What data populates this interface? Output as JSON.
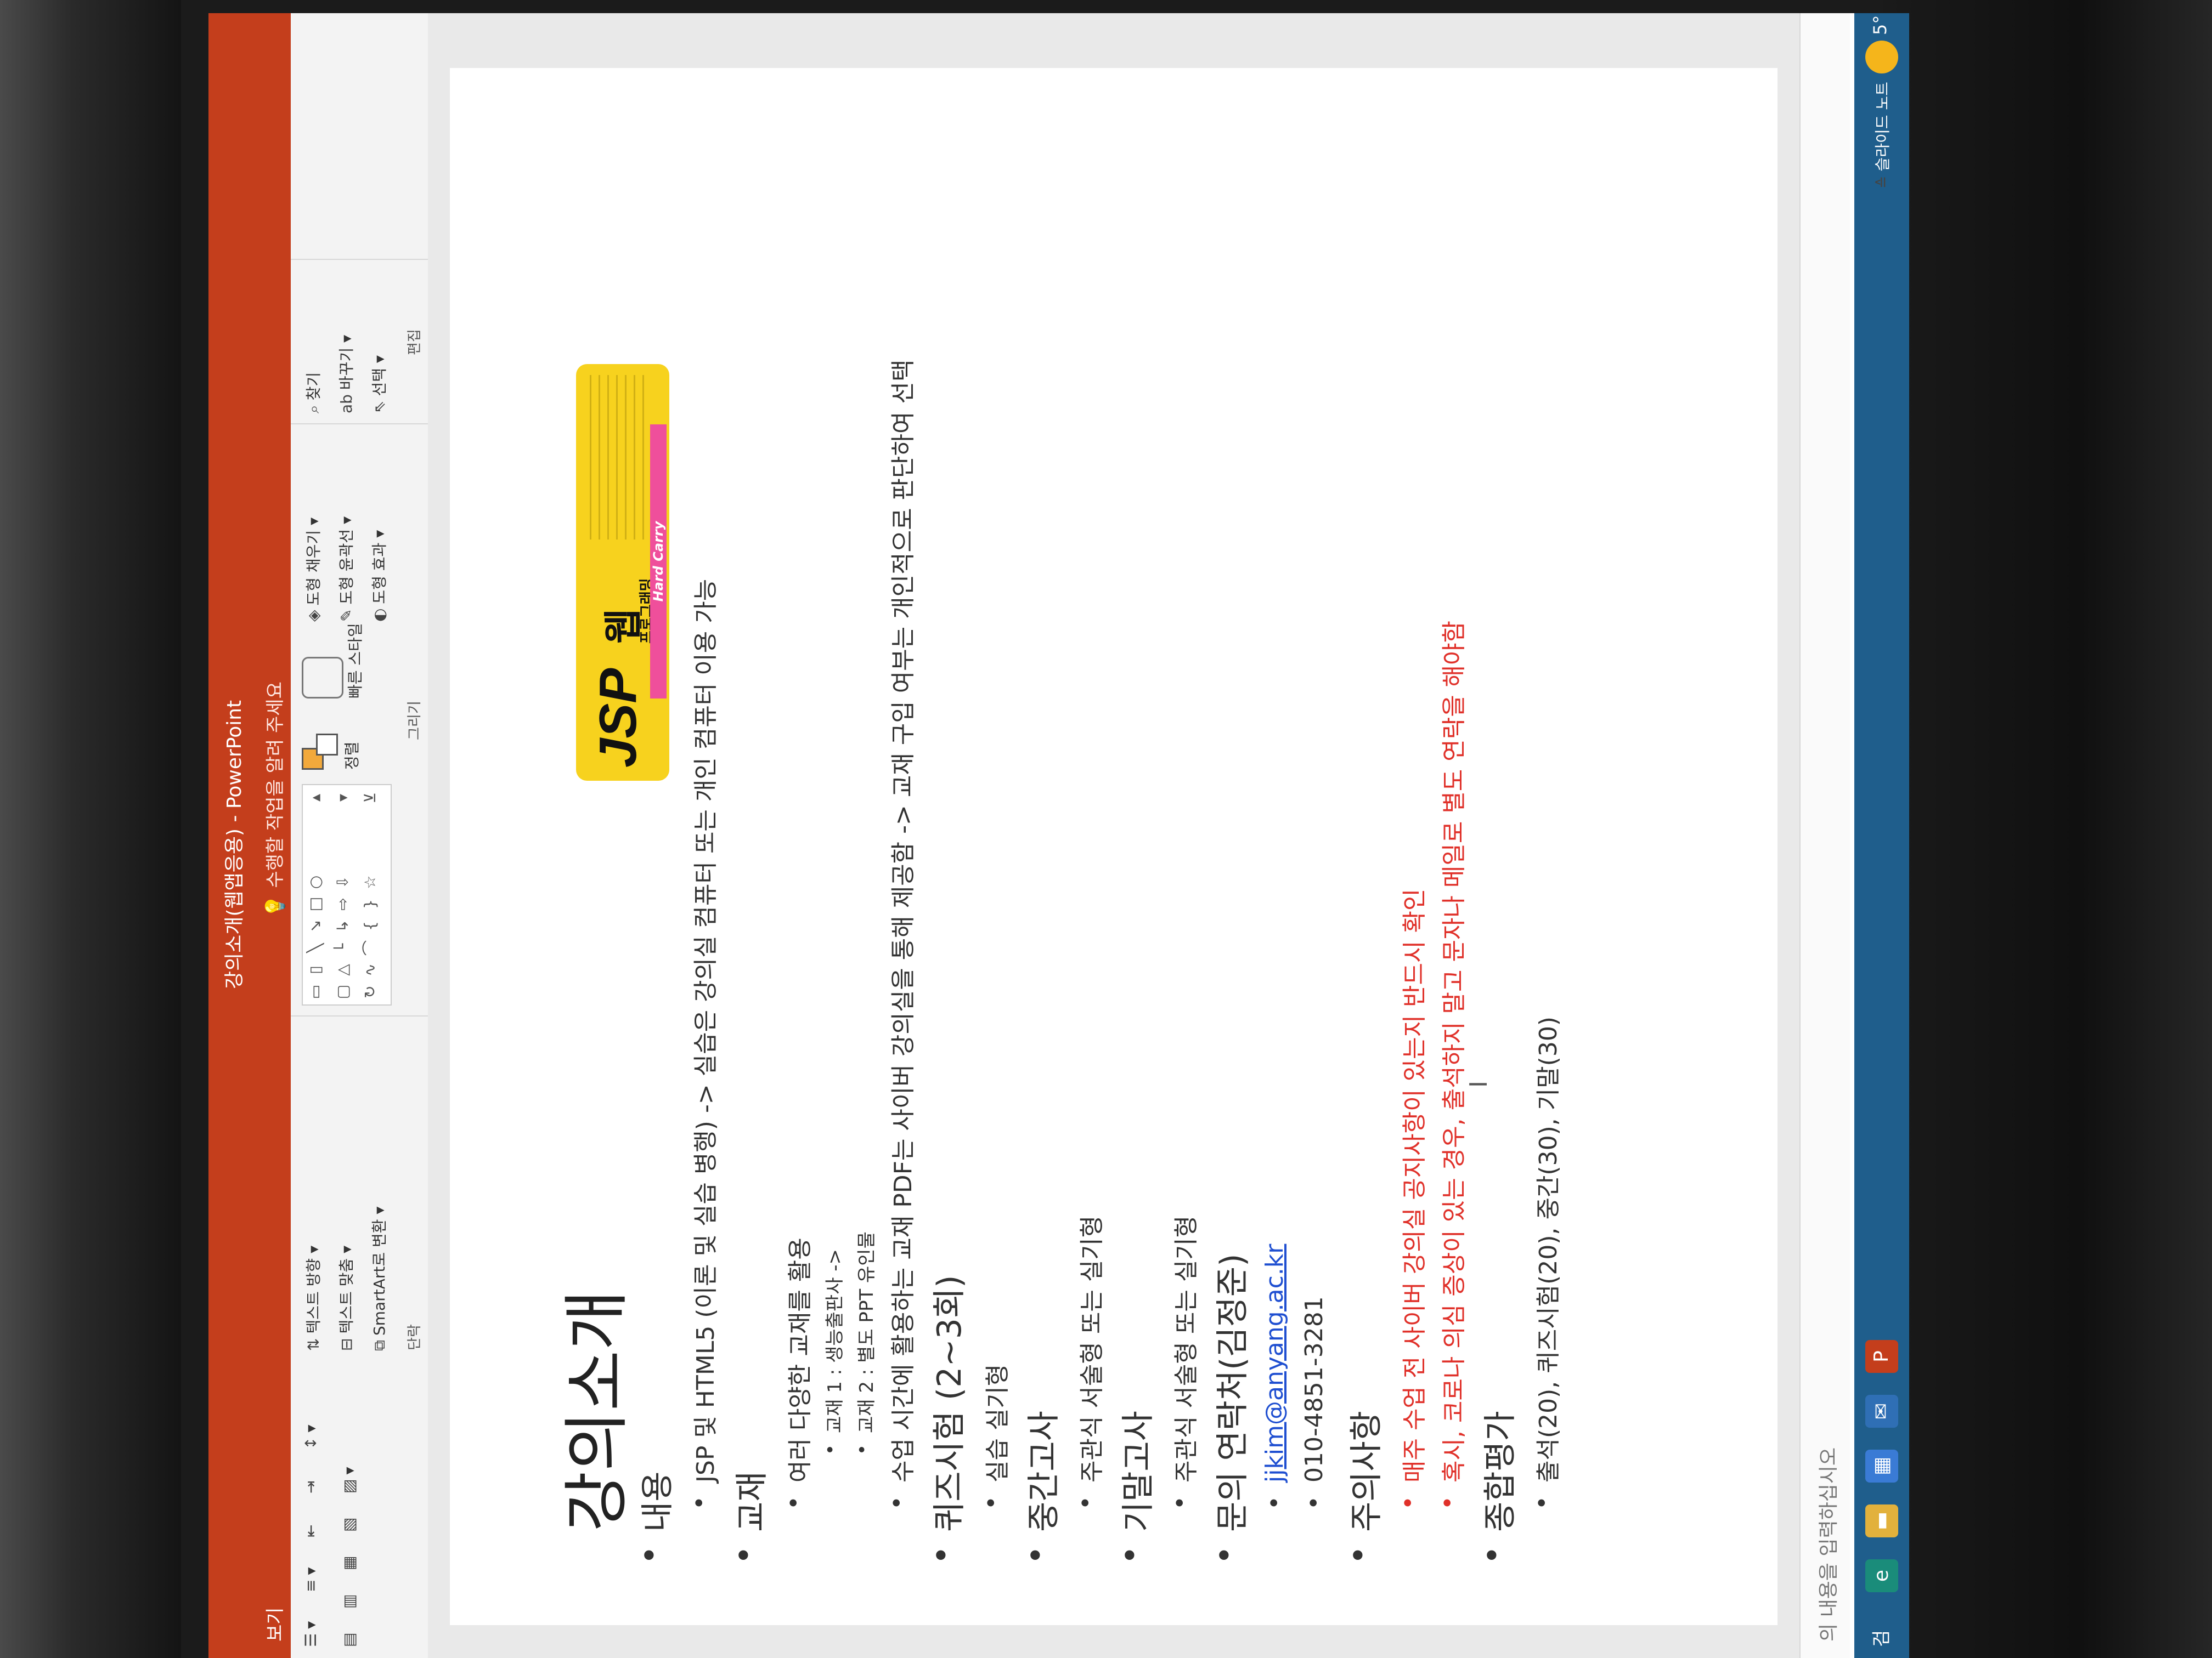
{
  "window": {
    "title": "강의소개(웹앱응용) - PowerPoint"
  },
  "tabs": {
    "view": "보기",
    "tell_me": "수행할 작업을 알려 주세요"
  },
  "ribbon": {
    "paragraph": {
      "label": "단락",
      "text_direction": "텍스트 방향",
      "align_text": "텍스트 맞춤",
      "smartart": "SmartArt로 변환"
    },
    "drawing": {
      "label": "그리기",
      "arrange": "정렬",
      "quick_styles": "빠른 스타일",
      "shape_fill": "도형 채우기",
      "shape_outline": "도형 윤곽선",
      "shape_effects": "도형 효과"
    },
    "editing": {
      "label": "편집",
      "find": "찾기",
      "replace": "바꾸기",
      "select": "선택"
    }
  },
  "slide": {
    "title": "강의소개",
    "items": [
      {
        "level": 1,
        "text": "내용",
        "red": false
      },
      {
        "level": 2,
        "text": "JSP 및 HTML5 (이론 및 실습 병행) -> 실습은 강의실 컴퓨터 또는 개인 컴퓨터 이용 가능",
        "red": false
      },
      {
        "level": 1,
        "text": "교재",
        "red": false
      },
      {
        "level": 2,
        "text": "여러 다양한 교재를 활용",
        "red": false
      },
      {
        "level": 3,
        "text": "교재 1 : 생능출판사 ->",
        "red": false
      },
      {
        "level": 3,
        "text": "교재 2 : 별도 PPT 유인물",
        "red": false
      },
      {
        "level": 2,
        "text": "수업 시간에 활용하는 교재 PDF는 사이버 강의실을 통해 제공함 -> 교재 구입 여부는 개인적으로 판단하여 선택",
        "red": false
      },
      {
        "level": 1,
        "text": "퀴즈시험 (2~3회)",
        "red": false
      },
      {
        "level": 2,
        "text": "실습 실기형",
        "red": false
      },
      {
        "level": 1,
        "text": "중간고사",
        "red": false
      },
      {
        "level": 2,
        "text": "주관식 서술형 또는 실기형",
        "red": false
      },
      {
        "level": 1,
        "text": "기말고사",
        "red": false
      },
      {
        "level": 2,
        "text": "주관식 서술형 또는 실기형",
        "red": false
      },
      {
        "level": 1,
        "text": "문의 연락처(김정준)",
        "red": false
      },
      {
        "level": 2,
        "text": "jjkim@anyang.ac.kr",
        "red": false,
        "link": true
      },
      {
        "level": 2,
        "text": "010-4851-3281",
        "red": false
      },
      {
        "level": 1,
        "text": "주의사항",
        "red": false
      },
      {
        "level": 2,
        "text": "매주 수업 전 사이버 강의실 공지사항이 있는지 반드시 확인",
        "red": true
      },
      {
        "level": 2,
        "text": "혹시, 코로나 의심 증상이 있는 경우, 출석하지 말고 문자나 메일로 별도 연락을 해야함",
        "red": true
      },
      {
        "level": 1,
        "text": "종합평가",
        "red": false
      },
      {
        "level": 2,
        "text": "출석(20), 퀴즈시험(20), 중간(30), 기말(30)",
        "red": false
      }
    ],
    "book": {
      "series": "JSP",
      "kor_title": "웹",
      "subtitle": "프로그래밍",
      "band": "Hard Carry"
    }
  },
  "notes": {
    "placeholder": "의 내용을 입력하십시오"
  },
  "status": {
    "slide_notes": "슬라이드 노트"
  },
  "taskbar": {
    "search_label": "검",
    "weather": "5°"
  },
  "colors": {
    "accent": "#c43e1c",
    "taskbar": "#1f5e8c",
    "warning": "#e0312a",
    "link": "#1f4fd1"
  }
}
